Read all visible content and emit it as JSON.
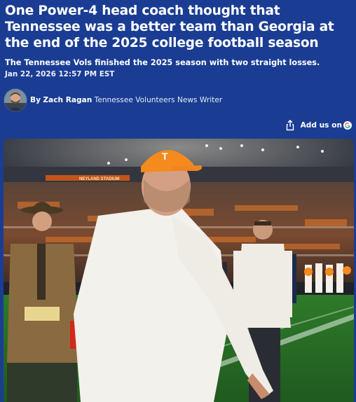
{
  "article": {
    "headline": "One Power-4 head coach thought that Tennessee was a better team than Georgia at the end of the 2025 college football season",
    "subheadline": "The Tennessee Vols finished the 2025 season with two straight losses.",
    "date": "Jan 22, 2026 12:57 PM EST"
  },
  "byline": {
    "prefix": "By",
    "author": "Zach Ragan",
    "role": "Tennessee Volunteers News Writer"
  },
  "actions": {
    "share_icon": "share-icon",
    "add_us_label": "Add us on",
    "google_icon": "google-icon"
  },
  "hero_image": {
    "description_icon": "photo-coach-on-field",
    "stadium_sign": "NEYLAND STADIUM"
  },
  "colors": {
    "background": "#1a3d93",
    "text": "#ffffff",
    "tennessee_orange": "#f58a1f"
  }
}
